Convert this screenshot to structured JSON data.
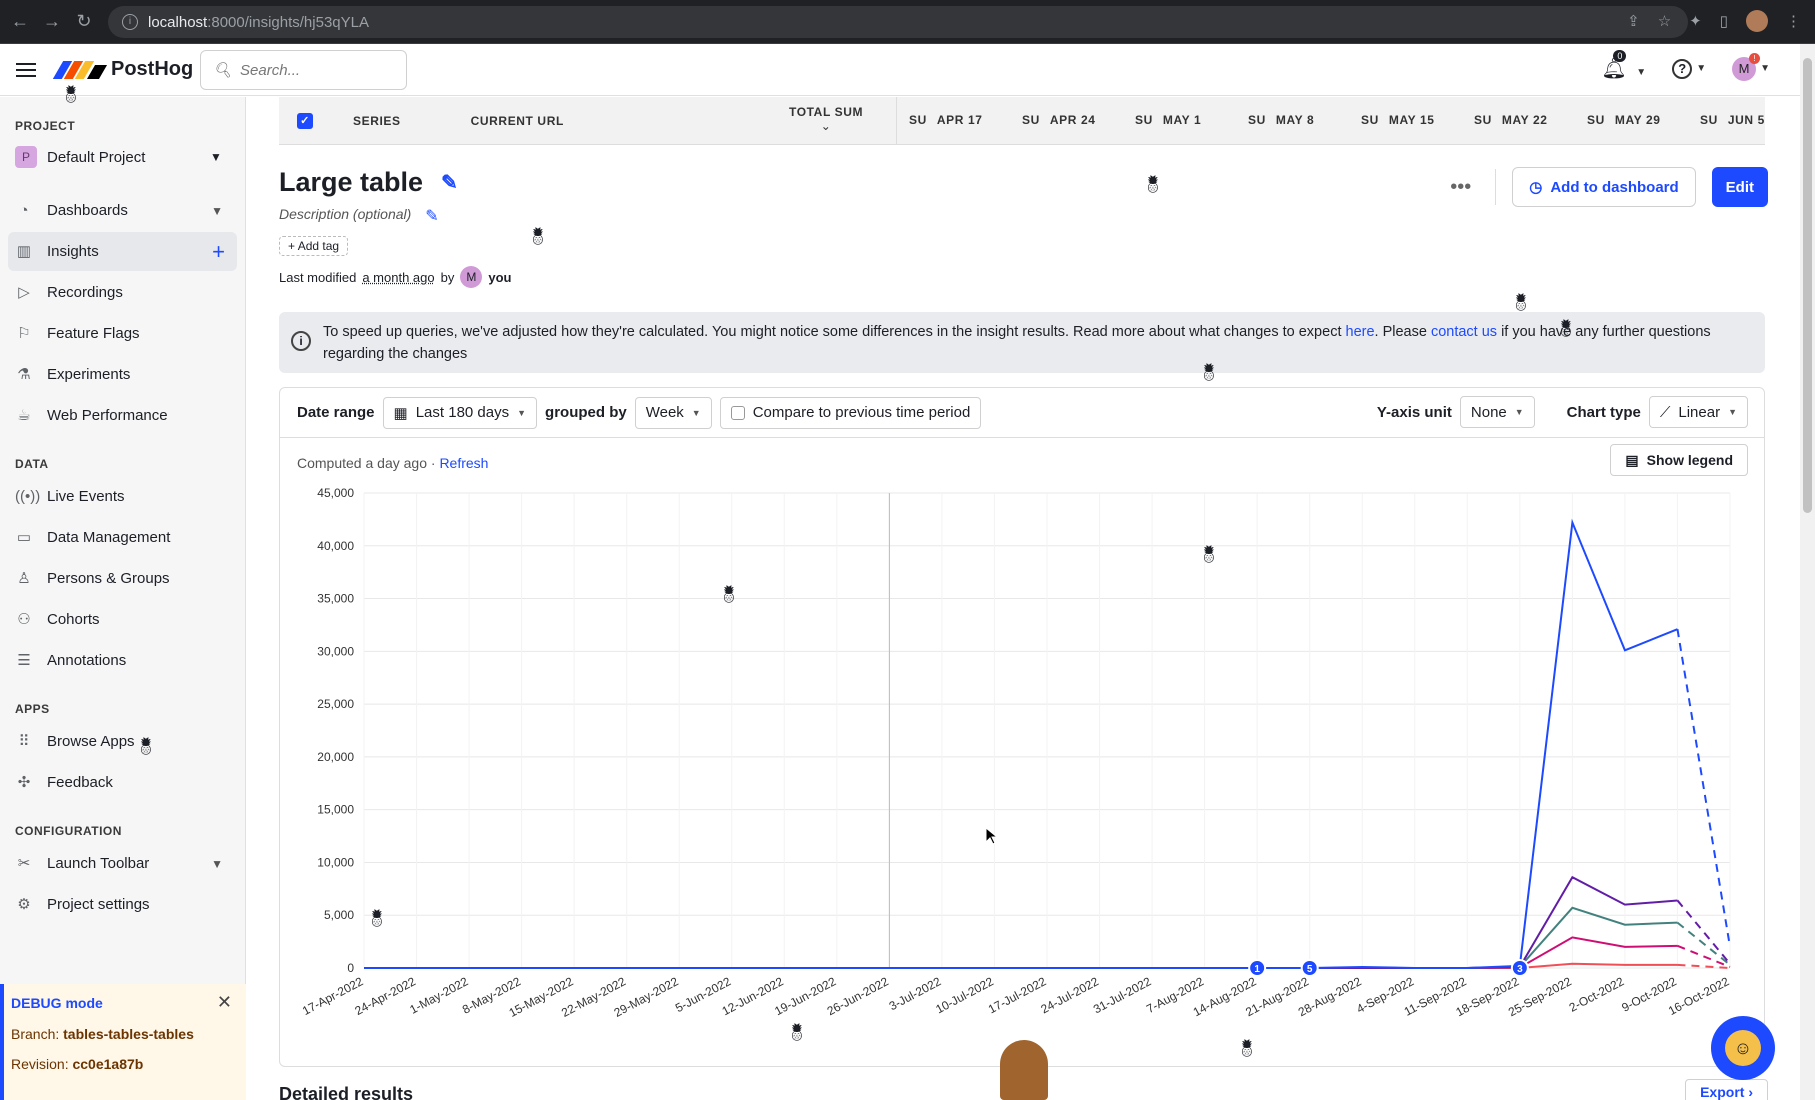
{
  "browser": {
    "url_host": "localhost",
    "url_path": ":8000/insights/hj53qYLA"
  },
  "topbar": {
    "brand": "PostHog",
    "search_placeholder": "Search...",
    "notifications_count": "0",
    "user_initial": "M",
    "user_badge": "!"
  },
  "sidebar": {
    "project_section": "PROJECT",
    "project_badge": "P",
    "project_name": "Default Project",
    "data_section": "DATA",
    "apps_section": "APPS",
    "config_section": "CONFIGURATION",
    "nav": [
      {
        "label": "Dashboards",
        "icon": "dashboard-icon"
      },
      {
        "label": "Insights",
        "icon": "bar-chart-icon"
      },
      {
        "label": "Recordings",
        "icon": "play-icon"
      },
      {
        "label": "Feature Flags",
        "icon": "flag-icon"
      },
      {
        "label": "Experiments",
        "icon": "flask-icon"
      },
      {
        "label": "Web Performance",
        "icon": "coffee-icon"
      }
    ],
    "data": [
      {
        "label": "Live Events",
        "icon": "broadcast-icon"
      },
      {
        "label": "Data Management",
        "icon": "monitor-icon"
      },
      {
        "label": "Persons & Groups",
        "icon": "person-icon"
      },
      {
        "label": "Cohorts",
        "icon": "people-icon"
      },
      {
        "label": "Annotations",
        "icon": "notes-icon"
      }
    ],
    "apps": [
      {
        "label": "Browse Apps",
        "icon": "grid-icon"
      },
      {
        "label": "Feedback",
        "icon": "puzzle-icon"
      }
    ],
    "config": [
      {
        "label": "Launch Toolbar",
        "icon": "tools-icon"
      },
      {
        "label": "Project settings",
        "icon": "gear-icon"
      }
    ],
    "debug": {
      "title": "DEBUG mode",
      "branch_label": "Branch:",
      "branch": "tables-tables-tables",
      "revision_label": "Revision:",
      "revision": "cc0e1a87b"
    }
  },
  "table_header": {
    "series": "SERIES",
    "current_url": "CURRENT URL",
    "total_sum": "TOTAL SUM",
    "weeks": [
      {
        "day": "SU",
        "date": "APR 17"
      },
      {
        "day": "SU",
        "date": "APR 24"
      },
      {
        "day": "SU",
        "date": "MAY 1"
      },
      {
        "day": "SU",
        "date": "MAY 8"
      },
      {
        "day": "SU",
        "date": "MAY 15"
      },
      {
        "day": "SU",
        "date": "MAY 22"
      },
      {
        "day": "SU",
        "date": "MAY 29"
      },
      {
        "day": "SU",
        "date": "JUN 5"
      }
    ]
  },
  "insight": {
    "title": "Large table",
    "description": "Description (optional)",
    "add_tag": "Add tag",
    "modified_prefix": "Last modified",
    "modified_when": "a month ago",
    "modified_by": "by",
    "modified_initial": "M",
    "modified_user": "you",
    "add_to_dashboard": "Add to dashboard",
    "edit": "Edit"
  },
  "notice": {
    "text1": "To speed up queries, we've adjusted how they're calculated. You might notice some differences in the insight results. Read more about what changes to expect ",
    "link1": "here",
    "text2": ". Please ",
    "link2": "contact us",
    "text3": " if you have any further questions regarding the changes"
  },
  "controls": {
    "date_range_label": "Date range",
    "date_range": "Last 180 days",
    "grouped_by_label": "grouped by",
    "interval": "Week",
    "compare_label": "Compare to previous time period",
    "y_unit_label": "Y-axis unit",
    "y_unit": "None",
    "chart_type_label": "Chart type",
    "chart_type": "Linear",
    "computed": "Computed a day ago",
    "refresh": "Refresh",
    "show_legend": "Show legend"
  },
  "footer": {
    "detailed_results": "Detailed results",
    "export": "Export"
  },
  "chart_data": {
    "type": "line",
    "ylim": [
      0,
      45000
    ],
    "yticks": [
      "0",
      "5,000",
      "10,000",
      "15,000",
      "20,000",
      "25,000",
      "30,000",
      "35,000",
      "40,000",
      "45,000"
    ],
    "categories": [
      "17-Apr-2022",
      "24-Apr-2022",
      "1-May-2022",
      "8-May-2022",
      "15-May-2022",
      "22-May-2022",
      "29-May-2022",
      "5-Jun-2022",
      "12-Jun-2022",
      "19-Jun-2022",
      "26-Jun-2022",
      "3-Jul-2022",
      "10-Jul-2022",
      "17-Jul-2022",
      "24-Jul-2022",
      "31-Jul-2022",
      "7-Aug-2022",
      "14-Aug-2022",
      "21-Aug-2022",
      "28-Aug-2022",
      "4-Sep-2022",
      "11-Sep-2022",
      "18-Sep-2022",
      "25-Sep-2022",
      "2-Oct-2022",
      "9-Oct-2022",
      "16-Oct-2022"
    ],
    "series": [
      {
        "color": "#1d4aff",
        "values": [
          0,
          0,
          0,
          0,
          0,
          0,
          0,
          0,
          0,
          0,
          0,
          0,
          0,
          0,
          0,
          0,
          0,
          0,
          0,
          100,
          0,
          0,
          200,
          42200,
          30100,
          32100,
          2000
        ]
      },
      {
        "color": "#621da6",
        "values": [
          0,
          0,
          0,
          0,
          0,
          0,
          0,
          0,
          0,
          0,
          0,
          0,
          0,
          0,
          0,
          0,
          0,
          0,
          0,
          0,
          0,
          0,
          100,
          8600,
          6000,
          6400,
          400
        ]
      },
      {
        "color": "#42827e",
        "values": [
          0,
          0,
          0,
          0,
          0,
          0,
          0,
          0,
          0,
          0,
          0,
          0,
          0,
          0,
          0,
          0,
          0,
          0,
          0,
          0,
          0,
          0,
          100,
          5700,
          4100,
          4300,
          300
        ]
      },
      {
        "color": "#ce0e74",
        "values": [
          0,
          0,
          0,
          0,
          0,
          0,
          0,
          0,
          0,
          0,
          0,
          0,
          0,
          0,
          0,
          0,
          0,
          0,
          0,
          0,
          0,
          0,
          50,
          2900,
          2000,
          2100,
          100
        ]
      },
      {
        "color": "#f14f58",
        "values": [
          0,
          0,
          0,
          0,
          0,
          0,
          0,
          0,
          0,
          0,
          0,
          0,
          0,
          0,
          0,
          0,
          0,
          0,
          0,
          0,
          0,
          0,
          0,
          400,
          300,
          300,
          0
        ]
      }
    ],
    "annotations": [
      {
        "index": 17,
        "label": "1"
      },
      {
        "index": 18,
        "label": "5"
      },
      {
        "index": 22,
        "label": "3"
      }
    ],
    "hover_index": 10,
    "incomplete_last_period": true
  }
}
